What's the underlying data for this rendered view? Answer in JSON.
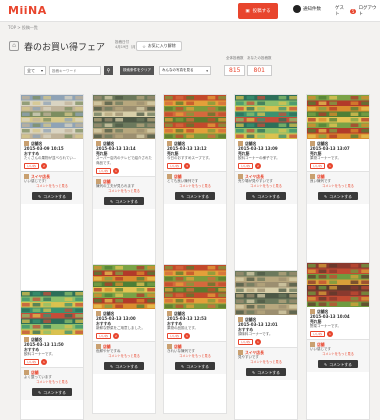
{
  "app": {
    "logo": "MiiNA"
  },
  "header": {
    "post_label": "投稿する",
    "notice_label": "通知件数",
    "notice_badge": "5",
    "user_label": "ゲスト",
    "logout_label": "ログアウト"
  },
  "breadcrumb": "TOP > 投稿一覧",
  "page": {
    "title": "春のお買い得フェア",
    "post_date_label": "投稿日付",
    "post_date": "4月19日（月）",
    "fav_label": "お気に入り解除"
  },
  "filters": {
    "select_value": "全て",
    "search_placeholder": "投稿キーワード",
    "clear_label": "検索条件をクリア",
    "sort_value": "みんなの写真を見る"
  },
  "stats": {
    "left_label": "全体投稿数",
    "left_value": "815",
    "right_label": "あなたの投稿数",
    "right_value": "801"
  },
  "colors": {
    "accent": "#e8452d",
    "dark_button": "#3a3a3a",
    "page_bg": "#f3f2f0"
  },
  "cards": [
    {
      "name": "店舗名",
      "date": "2015-03-09 10:15",
      "title": "おすすめ",
      "text": "たくさんの果物が並べられてい...",
      "like": "いいね",
      "count": "2",
      "commenter": "スイヤ店長",
      "comment": "いい感じです！",
      "more": "コメントをもっと見る",
      "comment_btn": "コメントする"
    },
    {
      "name": "店舗名",
      "date": "2015-03-13 13:14",
      "title": "売れ筋",
      "text": "スーパー店内のテレビで紹介された商品です。",
      "like": "いいね",
      "count": "1",
      "commenter": "店舗",
      "comment": "陳列の工夫が見られます",
      "more": "コメントをもっと見る",
      "comment_btn": "コメントする"
    },
    {
      "name": "店舗名",
      "date": "2015-03-13 13:12",
      "title": "売れ筋",
      "text": "今日のおすすめスープです。",
      "like": "いいね",
      "count": "3",
      "commenter": "店舗",
      "comment": "とても良い陳列です",
      "more": "コメントをもっと見る",
      "comment_btn": "コメントする"
    },
    {
      "name": "店舗名",
      "date": "2015-03-13 13:09",
      "title": "売れ筋",
      "text": "飲料コーナーの様子です。",
      "like": "いいね",
      "count": "2",
      "commenter": "スイヤ店長",
      "comment": "売り場が見やすいです",
      "more": "コメントをもっと見る",
      "comment_btn": "コメントする"
    },
    {
      "name": "店舗名",
      "date": "2015-03-13 13:07",
      "title": "売れ筋",
      "text": "果物コーナーです。",
      "like": "いいね",
      "count": "1",
      "commenter": "店舗",
      "comment": "良い陳列です",
      "more": "コメントをもっと見る",
      "comment_btn": "コメントする"
    },
    {
      "name": "店舗名",
      "date": "2015-03-13 13:00",
      "title": "おすすめ",
      "text": "新鮮な野菜をご用意しました。",
      "like": "いいね",
      "count": "2",
      "commenter": "店舗",
      "comment": "色鮮やかですね",
      "more": "コメントをもっと見る",
      "comment_btn": "コメントする"
    },
    {
      "name": "店舗名",
      "date": "2015-03-13 12:53",
      "title": "おすすめ",
      "text": "果物の品揃えです。",
      "like": "いいね",
      "count": "1",
      "commenter": "店舗",
      "comment": "きれいな陳列です",
      "more": "コメントをもっと見る",
      "comment_btn": "コメントする"
    },
    {
      "name": "店舗名",
      "date": "2015-03-13 12:01",
      "title": "おすすめ",
      "text": "調味料コーナーです。",
      "like": "いいね",
      "count": "1",
      "commenter": "スイヤ店長",
      "comment": "見やすいです",
      "more": "コメントをもっと見る",
      "comment_btn": "コメントする"
    },
    {
      "name": "店舗名",
      "date": "2015-03-13 11:50",
      "title": "おすすめ",
      "text": "飲料コーナーです。",
      "like": "いいね",
      "count": "1",
      "commenter": "店舗",
      "comment": "よく整っています",
      "more": "コメントをもっと見る",
      "comment_btn": "コメントする"
    },
    {
      "name": "店舗名",
      "date": "2015-03-13 10:04",
      "title": "売れ筋",
      "text": "野菜コーナーです。",
      "like": "いいね",
      "count": "1",
      "commenter": "店舗",
      "comment": "いい感じです",
      "more": "コメントをもっと見る",
      "comment_btn": "コメントする"
    }
  ]
}
